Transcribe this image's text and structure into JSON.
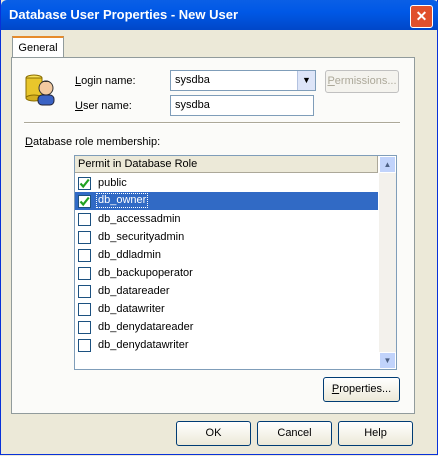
{
  "window": {
    "title": "Database User Properties - New User",
    "close_glyph": "✕"
  },
  "tabs": [
    {
      "label": "General"
    }
  ],
  "login": {
    "label_first": "L",
    "label_rest": "ogin name:",
    "value": "sysdba"
  },
  "user": {
    "label_first": "U",
    "label_rest": "ser name:",
    "value": "sysdba"
  },
  "permissions_button": {
    "label_first": "P",
    "label_rest": "ermissions..."
  },
  "role_section": {
    "label_first": "D",
    "label_rest": "atabase role membership:"
  },
  "role_grid": {
    "header": "Permit in Database Role",
    "rows": [
      {
        "name": "public",
        "checked": true,
        "selected": false
      },
      {
        "name": "db_owner",
        "checked": true,
        "selected": true
      },
      {
        "name": "db_accessadmin",
        "checked": false,
        "selected": false
      },
      {
        "name": "db_securityadmin",
        "checked": false,
        "selected": false
      },
      {
        "name": "db_ddladmin",
        "checked": false,
        "selected": false
      },
      {
        "name": "db_backupoperator",
        "checked": false,
        "selected": false
      },
      {
        "name": "db_datareader",
        "checked": false,
        "selected": false
      },
      {
        "name": "db_datawriter",
        "checked": false,
        "selected": false
      },
      {
        "name": "db_denydatareader",
        "checked": false,
        "selected": false
      },
      {
        "name": "db_denydatawriter",
        "checked": false,
        "selected": false
      }
    ]
  },
  "properties_button": {
    "label_first": "P",
    "label_rest": "roperties..."
  },
  "footer": {
    "ok": "OK",
    "cancel": "Cancel",
    "help": "Help"
  },
  "colors": {
    "titlebar": "#0058e6",
    "selection": "#316ac5",
    "check": "#21a121",
    "dialog_bg": "#ece9d8"
  },
  "icons": {
    "user": "database-user-icon",
    "combo_arrow": "chevron-down-icon",
    "scroll_up": "scroll-up-icon",
    "scroll_down": "scroll-down-icon"
  }
}
